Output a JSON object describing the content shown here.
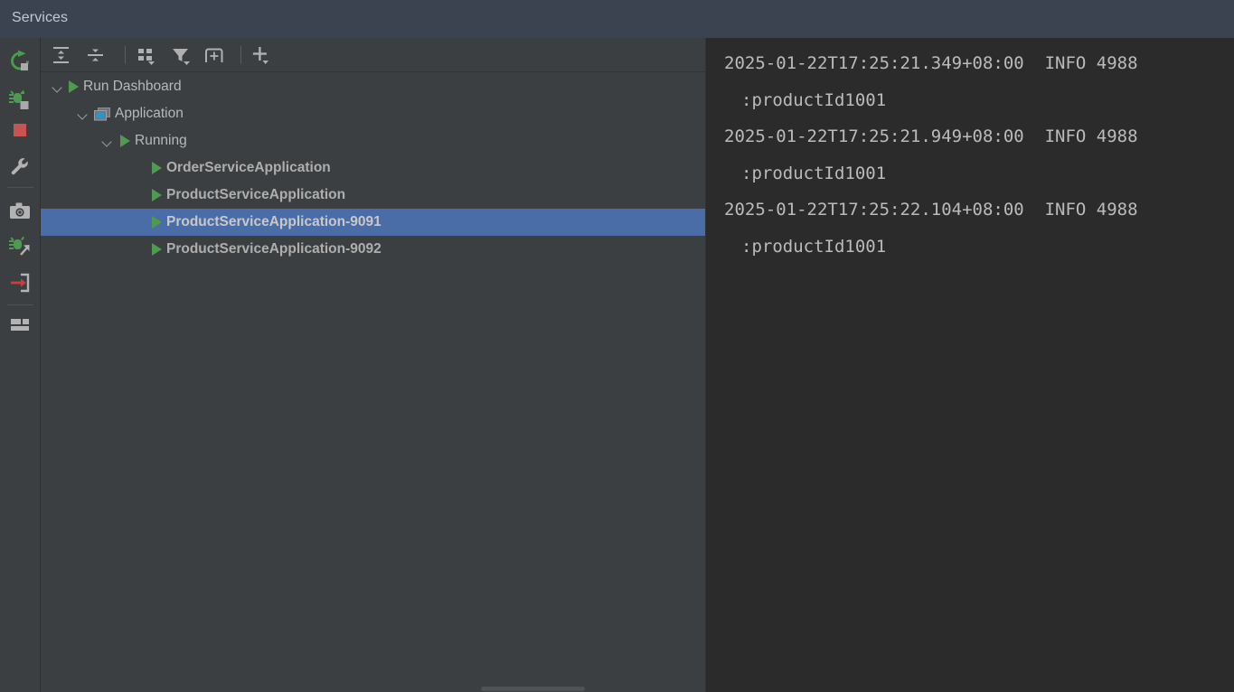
{
  "window": {
    "title": "Services"
  },
  "rail": {
    "items": [
      {
        "name": "rerun-icon",
        "label": "Rerun"
      },
      {
        "name": "rerun-failed-bug-icon",
        "label": "Rerun Failed Tests"
      },
      {
        "name": "stop-icon",
        "label": "Stop"
      },
      {
        "name": "wrench-settings-icon",
        "label": "Settings"
      },
      {
        "name": "camera-icon",
        "label": "Take Screenshot"
      },
      {
        "name": "bug-arrow-icon",
        "label": "Debug"
      },
      {
        "name": "attach-arrow-icon",
        "label": "Attach"
      },
      {
        "name": "layout-icon",
        "label": "Layout Settings"
      }
    ]
  },
  "toolbar": {
    "items": [
      {
        "name": "expand-all-icon",
        "label": "Expand All",
        "dropdown": false
      },
      {
        "name": "collapse-all-icon",
        "label": "Collapse All",
        "dropdown": false
      },
      {
        "name": "group-by-icon",
        "label": "Group By",
        "dropdown": true
      },
      {
        "name": "filter-icon",
        "label": "Filter",
        "dropdown": true
      },
      {
        "name": "add-tab-icon",
        "label": "Add Tab",
        "dropdown": false
      },
      {
        "name": "add-service-icon",
        "label": "Add Service",
        "dropdown": true
      }
    ]
  },
  "tree": {
    "nodes": [
      {
        "label": "Run Dashboard",
        "indent": 0,
        "icon": "run-triangle",
        "twisty": true,
        "bold": false,
        "selected": false
      },
      {
        "label": "Application",
        "indent": 1,
        "icon": "application",
        "twisty": true,
        "bold": false,
        "selected": false
      },
      {
        "label": "Running",
        "indent": 2,
        "icon": "run-triangle",
        "twisty": true,
        "bold": false,
        "selected": false
      },
      {
        "label": "OrderServiceApplication",
        "indent": 3,
        "icon": "run-triangle",
        "twisty": false,
        "bold": true,
        "selected": false
      },
      {
        "label": "ProductServiceApplication",
        "indent": 3,
        "icon": "run-triangle",
        "twisty": false,
        "bold": true,
        "selected": false
      },
      {
        "label": "ProductServiceApplication-9091",
        "indent": 3,
        "icon": "run-triangle",
        "twisty": false,
        "bold": true,
        "selected": true
      },
      {
        "label": "ProductServiceApplication-9092",
        "indent": 3,
        "icon": "run-triangle",
        "twisty": false,
        "bold": true,
        "selected": false
      }
    ]
  },
  "console": {
    "lines": [
      {
        "text": "2025-01-22T17:25:21.349+08:00  INFO 4988",
        "continuation": false
      },
      {
        "text": ":productId1001",
        "continuation": true
      },
      {
        "text": "2025-01-22T17:25:21.949+08:00  INFO 4988",
        "continuation": false
      },
      {
        "text": ":productId1001",
        "continuation": true
      },
      {
        "text": "2025-01-22T17:25:22.104+08:00  INFO 4988",
        "continuation": false
      },
      {
        "text": ":productId1001",
        "continuation": true
      }
    ]
  },
  "colors": {
    "titlebar_bg": "#3c4350",
    "panel_bg": "#3c3f41",
    "console_bg": "#2b2b2b",
    "selection_blue": "#4a6da7",
    "run_green": "#4e9a51",
    "stop_red": "#c75450",
    "app_teal": "#3592c4",
    "text_gray": "#a6a6a6"
  }
}
